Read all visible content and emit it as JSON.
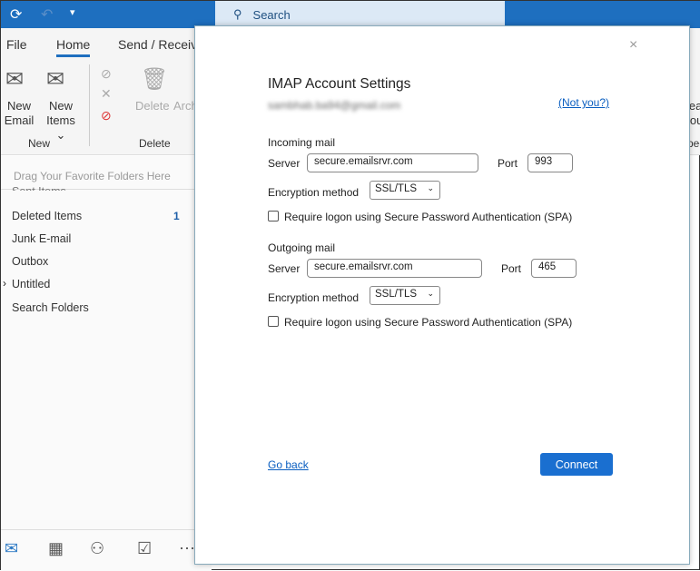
{
  "titlebar": {
    "search_placeholder": "Search"
  },
  "ribbon": {
    "tabs": [
      "File",
      "Home",
      "Send / Receive"
    ],
    "new_email": [
      "New",
      "Email"
    ],
    "new_items": [
      "New",
      "Items ⌄"
    ],
    "group_new": "New",
    "delete": "Delete",
    "archive": "Archive",
    "group_delete": "Delete",
    "read_aloud": [
      "Read",
      "Aloud"
    ],
    "group_speech": "Speech"
  },
  "folders": {
    "favorites_hint": "Drag Your Favorite Folders Here",
    "partial": "Sent Items",
    "items": [
      {
        "label": "Deleted Items",
        "count": "1"
      },
      {
        "label": "Junk E-mail"
      },
      {
        "label": "Outbox"
      },
      {
        "label": "Untitled"
      },
      {
        "label": "Search Folders"
      }
    ]
  },
  "dialog": {
    "title": "IMAP Account Settings",
    "email": "sambhab.ba94@gmail.com",
    "not_you": "(Not you?)",
    "incoming": {
      "heading": "Incoming mail",
      "server_label": "Server",
      "server": "secure.emailsrvr.com",
      "port_label": "Port",
      "port": "993",
      "enc_label": "Encryption method",
      "enc": "SSL/TLS",
      "spa": "Require logon using Secure Password Authentication (SPA)"
    },
    "outgoing": {
      "heading": "Outgoing mail",
      "server_label": "Server",
      "server": "secure.emailsrvr.com",
      "port_label": "Port",
      "port": "465",
      "enc_label": "Encryption method",
      "enc": "SSL/TLS",
      "spa": "Require logon using Secure Password Authentication (SPA)"
    },
    "go_back": "Go back",
    "connect": "Connect"
  }
}
